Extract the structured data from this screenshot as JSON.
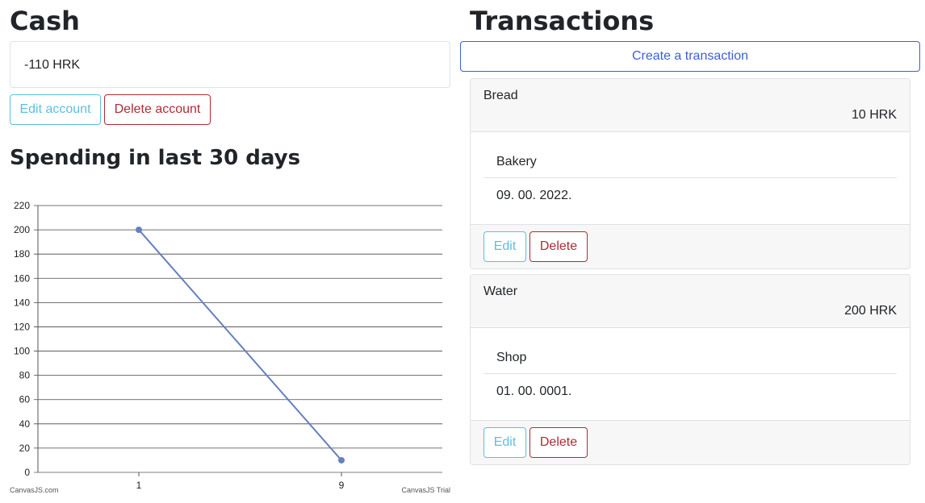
{
  "cash": {
    "title": "Cash",
    "balance": "-110 HRK",
    "edit_label": "Edit account",
    "delete_label": "Delete account"
  },
  "spending": {
    "title": "Spending in last 30 days",
    "credit_left": "CanvasJS.com",
    "credit_right": "CanvasJS Trial"
  },
  "chart_data": {
    "type": "line",
    "title": "",
    "xlabel": "",
    "ylabel": "",
    "categories": [
      "1",
      "9"
    ],
    "values": [
      200,
      10
    ],
    "ylim": [
      0,
      220
    ],
    "yticks": [
      0,
      20,
      40,
      60,
      80,
      100,
      120,
      140,
      160,
      180,
      200,
      220
    ],
    "grid": true,
    "line_color": "#6480bf"
  },
  "transactions": {
    "title": "Transactions",
    "create_label": "Create a transaction",
    "items": [
      {
        "name": "Bread",
        "amount": "10 HRK",
        "category": "Bakery",
        "date": "09. 00. 2022.",
        "edit_label": "Edit",
        "delete_label": "Delete"
      },
      {
        "name": "Water",
        "amount": "200 HRK",
        "category": "Shop",
        "date": "01. 00. 0001.",
        "edit_label": "Edit",
        "delete_label": "Delete"
      }
    ]
  },
  "colors": {
    "info": "#5bc0de",
    "danger": "#b02a37",
    "primary": "#3b5fd9"
  }
}
